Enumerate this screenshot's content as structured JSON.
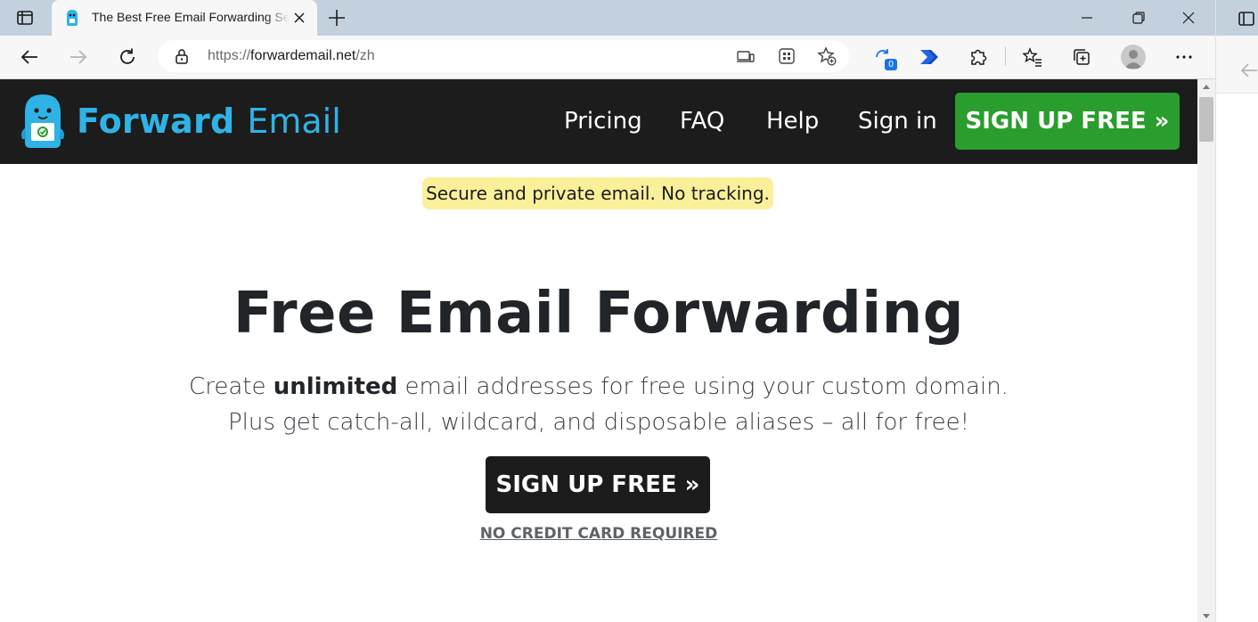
{
  "browser": {
    "tab": {
      "title": "The Best Free Email Forwarding Service"
    },
    "address": {
      "scheme": "https://",
      "host": "forwardemail.net",
      "path": "/zh"
    },
    "extension_badge": "0"
  },
  "site": {
    "brand_bold": "Forward",
    "brand_light": "Email",
    "nav": [
      "Pricing",
      "FAQ",
      "Help",
      "Sign in"
    ],
    "nav_cta": "SIGN UP FREE »",
    "tagline": "Secure and private email. No tracking.",
    "hero": {
      "title": "Free Email Forwarding",
      "line1_pre": "Create ",
      "line1_bold": "unlimited",
      "line1_post": " email addresses for free using your custom domain.",
      "line2": "Plus get catch-all, wildcard, and disposable aliases – all for free!",
      "cta": "SIGN UP FREE »",
      "note": "NO CREDIT CARD REQUIRED"
    }
  },
  "colors": {
    "brand_blue": "#2fb3e6",
    "nav_bg": "#1c1c1c",
    "signup_green": "#2a9d2f",
    "tagline_highlight": "#fbf09a"
  }
}
